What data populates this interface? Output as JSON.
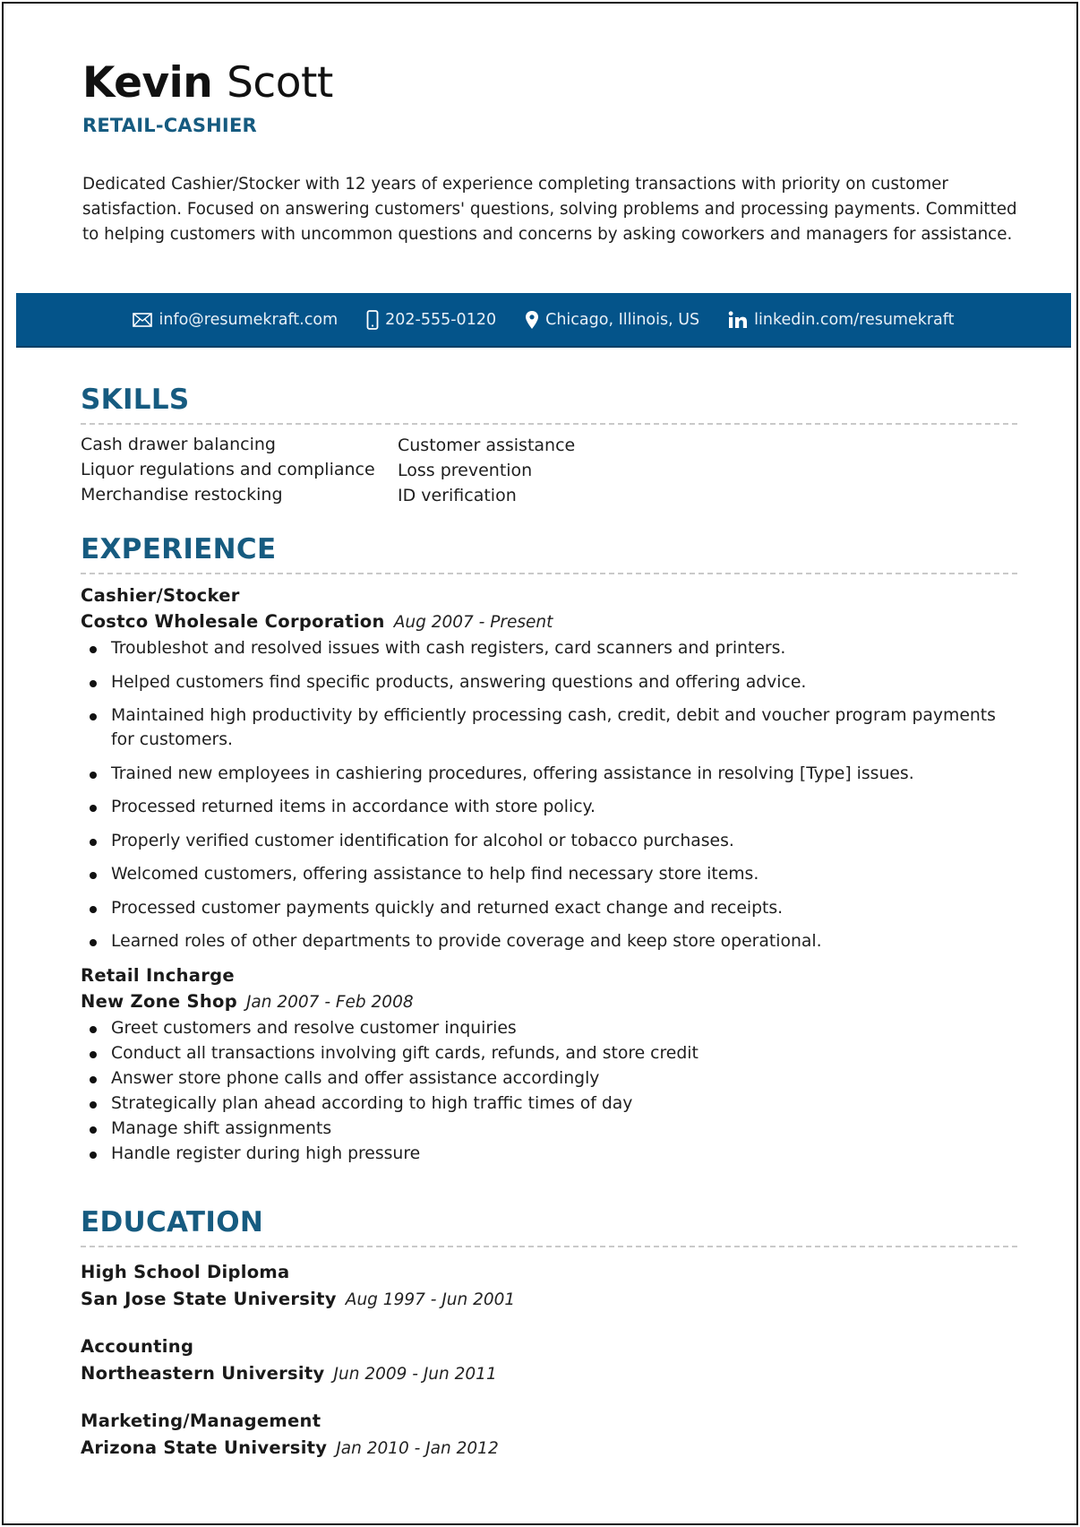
{
  "header": {
    "first_name": "Kevin",
    "last_name": "Scott",
    "role": "RETAIL-CASHIER"
  },
  "summary": "Dedicated Cashier/Stocker with 12 years of experience completing transactions with priority on customer satisfaction. Focused on answering customers' questions, solving problems and processing payments. Committed to helping customers with uncommon questions and concerns by asking coworkers and managers for assistance.",
  "contact": {
    "bar_color": "#04548a",
    "items": [
      {
        "icon": "envelope-icon",
        "text": "info@resumekraft.com"
      },
      {
        "icon": "mobile-phone-icon",
        "text": "202-555-0120"
      },
      {
        "icon": "map-pin-icon",
        "text": "Chicago, Illinois, US"
      },
      {
        "icon": "linkedin-icon",
        "text": "linkedin.com/resumekraft"
      }
    ]
  },
  "accent_color": "#165b80",
  "skills": {
    "title": "SKILLS",
    "left": [
      "Cash drawer balancing",
      "Liquor regulations and compliance",
      "Merchandise restocking"
    ],
    "right": [
      "Customer assistance",
      "Loss prevention",
      "ID verification"
    ]
  },
  "experience": {
    "title": "EXPERIENCE",
    "jobs": [
      {
        "title": "Cashier/Stocker",
        "company": "Costco Wholesale Corporation",
        "dates": "Aug 2007 - Present",
        "bullets": [
          "Troubleshot and resolved issues with cash registers, card scanners and printers.",
          "Helped customers find specific products, answering questions and offering advice.",
          "Maintained high productivity by efficiently processing cash, credit, debit and voucher program payments for customers.",
          "Trained new employees in cashiering procedures, offering assistance in resolving [Type] issues.",
          "Processed returned items in accordance with store policy.",
          "Properly verified customer identification for alcohol or tobacco purchases.",
          "Welcomed customers, offering assistance to help find necessary store items.",
          "Processed customer payments quickly and returned exact change and receipts.",
          "Learned roles of other departments to provide coverage and keep store operational."
        ]
      },
      {
        "title": "Retail Incharge",
        "company": "New Zone Shop",
        "dates": "Jan 2007 - Feb 2008",
        "bullets": [
          "Greet customers and resolve customer inquiries",
          "Conduct all transactions involving gift cards, refunds, and store credit",
          "Answer store phone calls and offer assistance accordingly",
          "Strategically plan ahead according to high traffic times of day",
          "Manage shift assignments",
          "Handle register during high pressure"
        ]
      }
    ]
  },
  "education": {
    "title": "EDUCATION",
    "items": [
      {
        "degree": "High School Diploma",
        "school": "San Jose State University",
        "dates": "Aug 1997 - Jun 2001"
      },
      {
        "degree": "Accounting",
        "school": "Northeastern University",
        "dates": "Jun 2009 - Jun 2011"
      },
      {
        "degree": "Marketing/Management",
        "school": "Arizona State University",
        "dates": "Jan 2010 - Jan 2012"
      }
    ]
  }
}
